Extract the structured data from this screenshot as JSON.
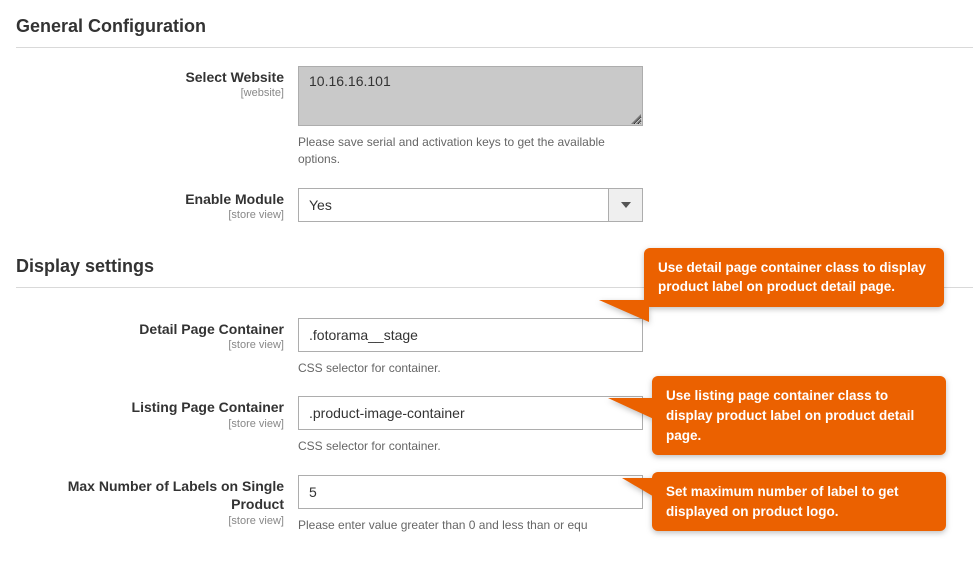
{
  "general": {
    "title": "General Configuration",
    "select_website": {
      "label": "Select Website",
      "scope": "[website]",
      "value": "10.16.16.101",
      "help": "Please save serial and activation keys to get the available options."
    },
    "enable_module": {
      "label": "Enable Module",
      "scope": "[store view]",
      "value": "Yes"
    }
  },
  "display": {
    "title": "Display settings",
    "detail_container": {
      "label": "Detail Page Container",
      "scope": "[store view]",
      "value": ".fotorama__stage",
      "help": "CSS selector for container.",
      "callout": "Use detail page container class to display product label on product detail page."
    },
    "listing_container": {
      "label": "Listing Page Container",
      "scope": "[store view]",
      "value": ".product-image-container",
      "help": "CSS selector for container.",
      "callout": "Use listing page container class to display product label on product detail page."
    },
    "max_labels": {
      "label": "Max Number of Labels on Single Product",
      "scope": "[store view]",
      "value": "5",
      "help": "Please enter value greater than 0 and less than or equ",
      "callout": "Set maximum number of label to get displayed on product logo."
    }
  }
}
